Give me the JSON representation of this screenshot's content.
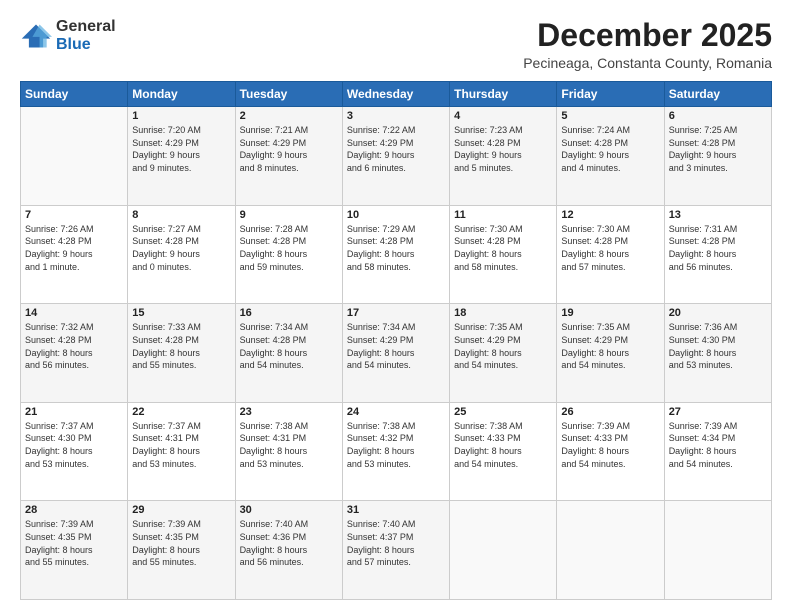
{
  "header": {
    "logo_general": "General",
    "logo_blue": "Blue",
    "main_title": "December 2025",
    "subtitle": "Pecineaga, Constanta County, Romania"
  },
  "calendar": {
    "days_of_week": [
      "Sunday",
      "Monday",
      "Tuesday",
      "Wednesday",
      "Thursday",
      "Friday",
      "Saturday"
    ],
    "weeks": [
      [
        {
          "day": "",
          "info": ""
        },
        {
          "day": "1",
          "info": "Sunrise: 7:20 AM\nSunset: 4:29 PM\nDaylight: 9 hours\nand 9 minutes."
        },
        {
          "day": "2",
          "info": "Sunrise: 7:21 AM\nSunset: 4:29 PM\nDaylight: 9 hours\nand 8 minutes."
        },
        {
          "day": "3",
          "info": "Sunrise: 7:22 AM\nSunset: 4:29 PM\nDaylight: 9 hours\nand 6 minutes."
        },
        {
          "day": "4",
          "info": "Sunrise: 7:23 AM\nSunset: 4:28 PM\nDaylight: 9 hours\nand 5 minutes."
        },
        {
          "day": "5",
          "info": "Sunrise: 7:24 AM\nSunset: 4:28 PM\nDaylight: 9 hours\nand 4 minutes."
        },
        {
          "day": "6",
          "info": "Sunrise: 7:25 AM\nSunset: 4:28 PM\nDaylight: 9 hours\nand 3 minutes."
        }
      ],
      [
        {
          "day": "7",
          "info": "Sunrise: 7:26 AM\nSunset: 4:28 PM\nDaylight: 9 hours\nand 1 minute."
        },
        {
          "day": "8",
          "info": "Sunrise: 7:27 AM\nSunset: 4:28 PM\nDaylight: 9 hours\nand 0 minutes."
        },
        {
          "day": "9",
          "info": "Sunrise: 7:28 AM\nSunset: 4:28 PM\nDaylight: 8 hours\nand 59 minutes."
        },
        {
          "day": "10",
          "info": "Sunrise: 7:29 AM\nSunset: 4:28 PM\nDaylight: 8 hours\nand 58 minutes."
        },
        {
          "day": "11",
          "info": "Sunrise: 7:30 AM\nSunset: 4:28 PM\nDaylight: 8 hours\nand 58 minutes."
        },
        {
          "day": "12",
          "info": "Sunrise: 7:30 AM\nSunset: 4:28 PM\nDaylight: 8 hours\nand 57 minutes."
        },
        {
          "day": "13",
          "info": "Sunrise: 7:31 AM\nSunset: 4:28 PM\nDaylight: 8 hours\nand 56 minutes."
        }
      ],
      [
        {
          "day": "14",
          "info": "Sunrise: 7:32 AM\nSunset: 4:28 PM\nDaylight: 8 hours\nand 56 minutes."
        },
        {
          "day": "15",
          "info": "Sunrise: 7:33 AM\nSunset: 4:28 PM\nDaylight: 8 hours\nand 55 minutes."
        },
        {
          "day": "16",
          "info": "Sunrise: 7:34 AM\nSunset: 4:28 PM\nDaylight: 8 hours\nand 54 minutes."
        },
        {
          "day": "17",
          "info": "Sunrise: 7:34 AM\nSunset: 4:29 PM\nDaylight: 8 hours\nand 54 minutes."
        },
        {
          "day": "18",
          "info": "Sunrise: 7:35 AM\nSunset: 4:29 PM\nDaylight: 8 hours\nand 54 minutes."
        },
        {
          "day": "19",
          "info": "Sunrise: 7:35 AM\nSunset: 4:29 PM\nDaylight: 8 hours\nand 54 minutes."
        },
        {
          "day": "20",
          "info": "Sunrise: 7:36 AM\nSunset: 4:30 PM\nDaylight: 8 hours\nand 53 minutes."
        }
      ],
      [
        {
          "day": "21",
          "info": "Sunrise: 7:37 AM\nSunset: 4:30 PM\nDaylight: 8 hours\nand 53 minutes."
        },
        {
          "day": "22",
          "info": "Sunrise: 7:37 AM\nSunset: 4:31 PM\nDaylight: 8 hours\nand 53 minutes."
        },
        {
          "day": "23",
          "info": "Sunrise: 7:38 AM\nSunset: 4:31 PM\nDaylight: 8 hours\nand 53 minutes."
        },
        {
          "day": "24",
          "info": "Sunrise: 7:38 AM\nSunset: 4:32 PM\nDaylight: 8 hours\nand 53 minutes."
        },
        {
          "day": "25",
          "info": "Sunrise: 7:38 AM\nSunset: 4:33 PM\nDaylight: 8 hours\nand 54 minutes."
        },
        {
          "day": "26",
          "info": "Sunrise: 7:39 AM\nSunset: 4:33 PM\nDaylight: 8 hours\nand 54 minutes."
        },
        {
          "day": "27",
          "info": "Sunrise: 7:39 AM\nSunset: 4:34 PM\nDaylight: 8 hours\nand 54 minutes."
        }
      ],
      [
        {
          "day": "28",
          "info": "Sunrise: 7:39 AM\nSunset: 4:35 PM\nDaylight: 8 hours\nand 55 minutes."
        },
        {
          "day": "29",
          "info": "Sunrise: 7:39 AM\nSunset: 4:35 PM\nDaylight: 8 hours\nand 55 minutes."
        },
        {
          "day": "30",
          "info": "Sunrise: 7:40 AM\nSunset: 4:36 PM\nDaylight: 8 hours\nand 56 minutes."
        },
        {
          "day": "31",
          "info": "Sunrise: 7:40 AM\nSunset: 4:37 PM\nDaylight: 8 hours\nand 57 minutes."
        },
        {
          "day": "",
          "info": ""
        },
        {
          "day": "",
          "info": ""
        },
        {
          "day": "",
          "info": ""
        }
      ]
    ]
  }
}
